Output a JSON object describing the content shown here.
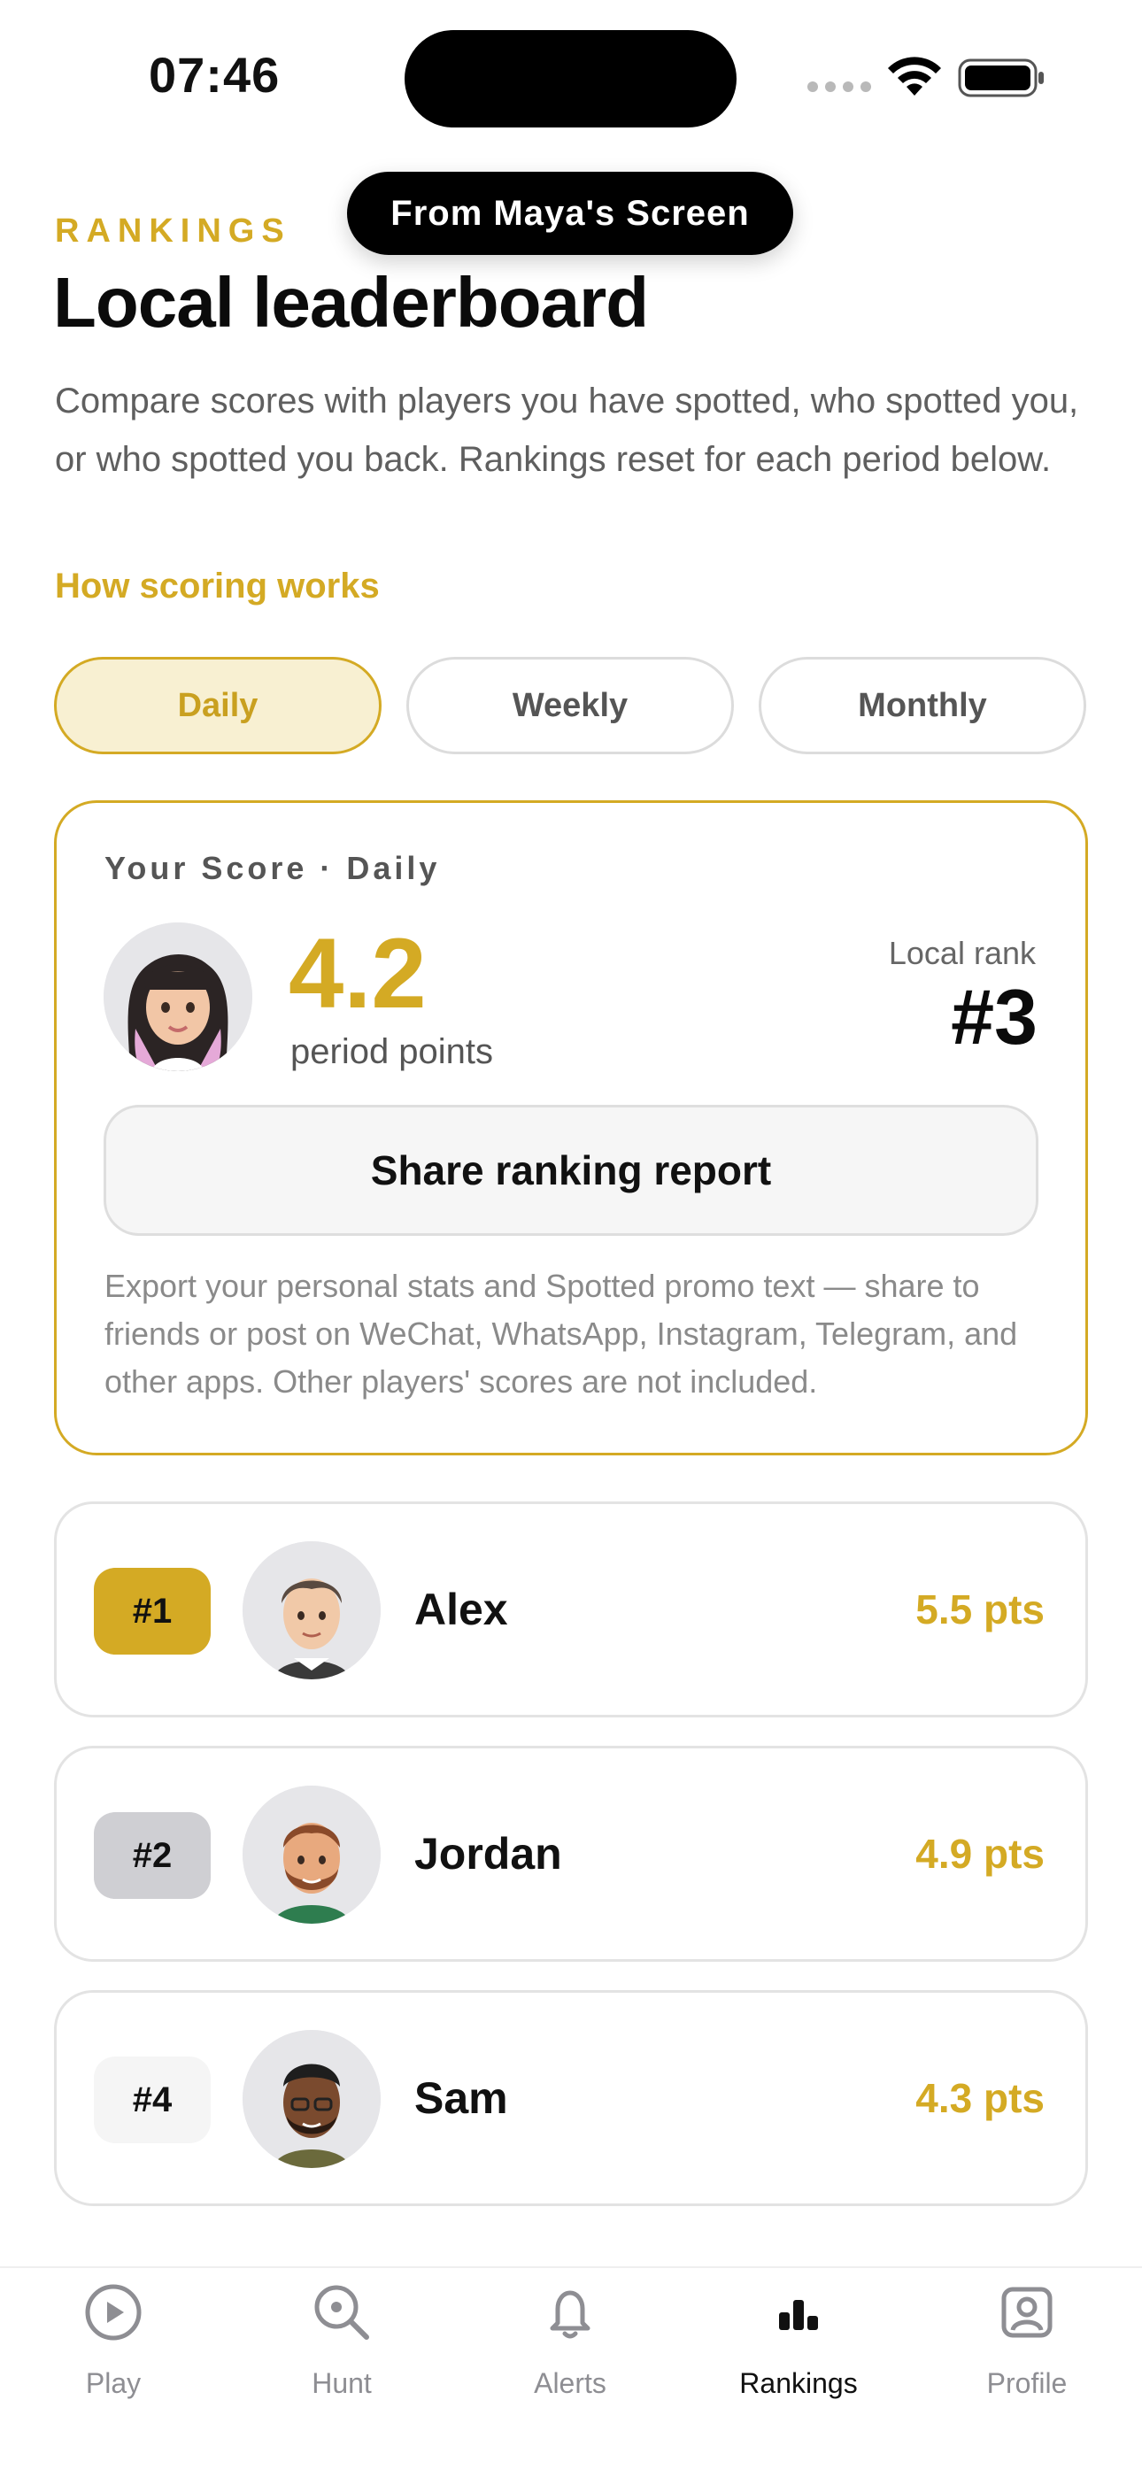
{
  "status_bar": {
    "time": "07:46"
  },
  "toast": {
    "label": "From Maya's Screen"
  },
  "header": {
    "eyebrow": "RANKINGS",
    "title": "Local leaderboard",
    "description": "Compare scores with players you have spotted, who spotted you, or who spotted you back. Rankings reset for each period below.",
    "scoring_link": "How scoring works"
  },
  "period_tabs": [
    {
      "label": "Daily",
      "active": true
    },
    {
      "label": "Weekly",
      "active": false
    },
    {
      "label": "Monthly",
      "active": false
    }
  ],
  "score_card": {
    "label": "Your Score · Daily",
    "score": "4.2",
    "score_caption": "period points",
    "rank_label": "Local rank",
    "rank_value": "#3",
    "share_button": "Share ranking report",
    "share_description": "Export your personal stats and Spotted promo text — share to friends or post on WeChat, WhatsApp, Instagram, Telegram, and other apps. Other players' scores are not included."
  },
  "leaderboard": [
    {
      "rank": "#1",
      "name": "Alex",
      "points": "5.5 pts",
      "badge_color": "#d4aa24"
    },
    {
      "rank": "#2",
      "name": "Jordan",
      "points": "4.9 pts",
      "badge_color": "#cfcfd3"
    },
    {
      "rank": "#4",
      "name": "Sam",
      "points": "4.3 pts",
      "badge_color": "#f5f5f5"
    }
  ],
  "tab_bar": [
    {
      "label": "Play",
      "icon": "play-icon",
      "active": false
    },
    {
      "label": "Hunt",
      "icon": "search-icon",
      "active": false
    },
    {
      "label": "Alerts",
      "icon": "bell-icon",
      "active": false
    },
    {
      "label": "Rankings",
      "icon": "bar-chart-icon",
      "active": true
    },
    {
      "label": "Profile",
      "icon": "profile-icon",
      "active": false
    }
  ],
  "colors": {
    "accent": "#d4aa24",
    "accent_soft": "#f8f0d2"
  }
}
